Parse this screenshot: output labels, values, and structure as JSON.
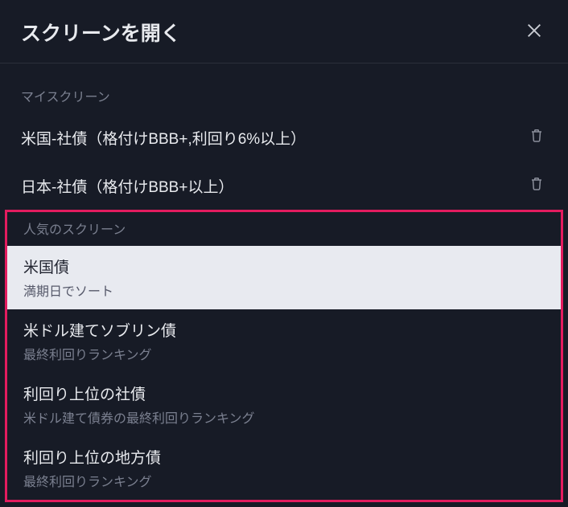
{
  "header": {
    "title": "スクリーンを開く"
  },
  "sections": {
    "my_screens_label": "マイスクリーン",
    "popular_screens_label": "人気のスクリーン"
  },
  "my_screens": [
    {
      "label": "米国-社債（格付けBBB+,利回り6%以上）"
    },
    {
      "label": "日本-社債（格付けBBB+以上）"
    }
  ],
  "popular_screens": [
    {
      "title": "米国債",
      "subtitle": "満期日でソート",
      "active": true
    },
    {
      "title": "米ドル建てソブリン債",
      "subtitle": "最終利回りランキング",
      "active": false
    },
    {
      "title": "利回り上位の社債",
      "subtitle": "米ドル建て債券の最終利回りランキング",
      "active": false
    },
    {
      "title": "利回り上位の地方債",
      "subtitle": "最終利回りランキング",
      "active": false
    }
  ]
}
